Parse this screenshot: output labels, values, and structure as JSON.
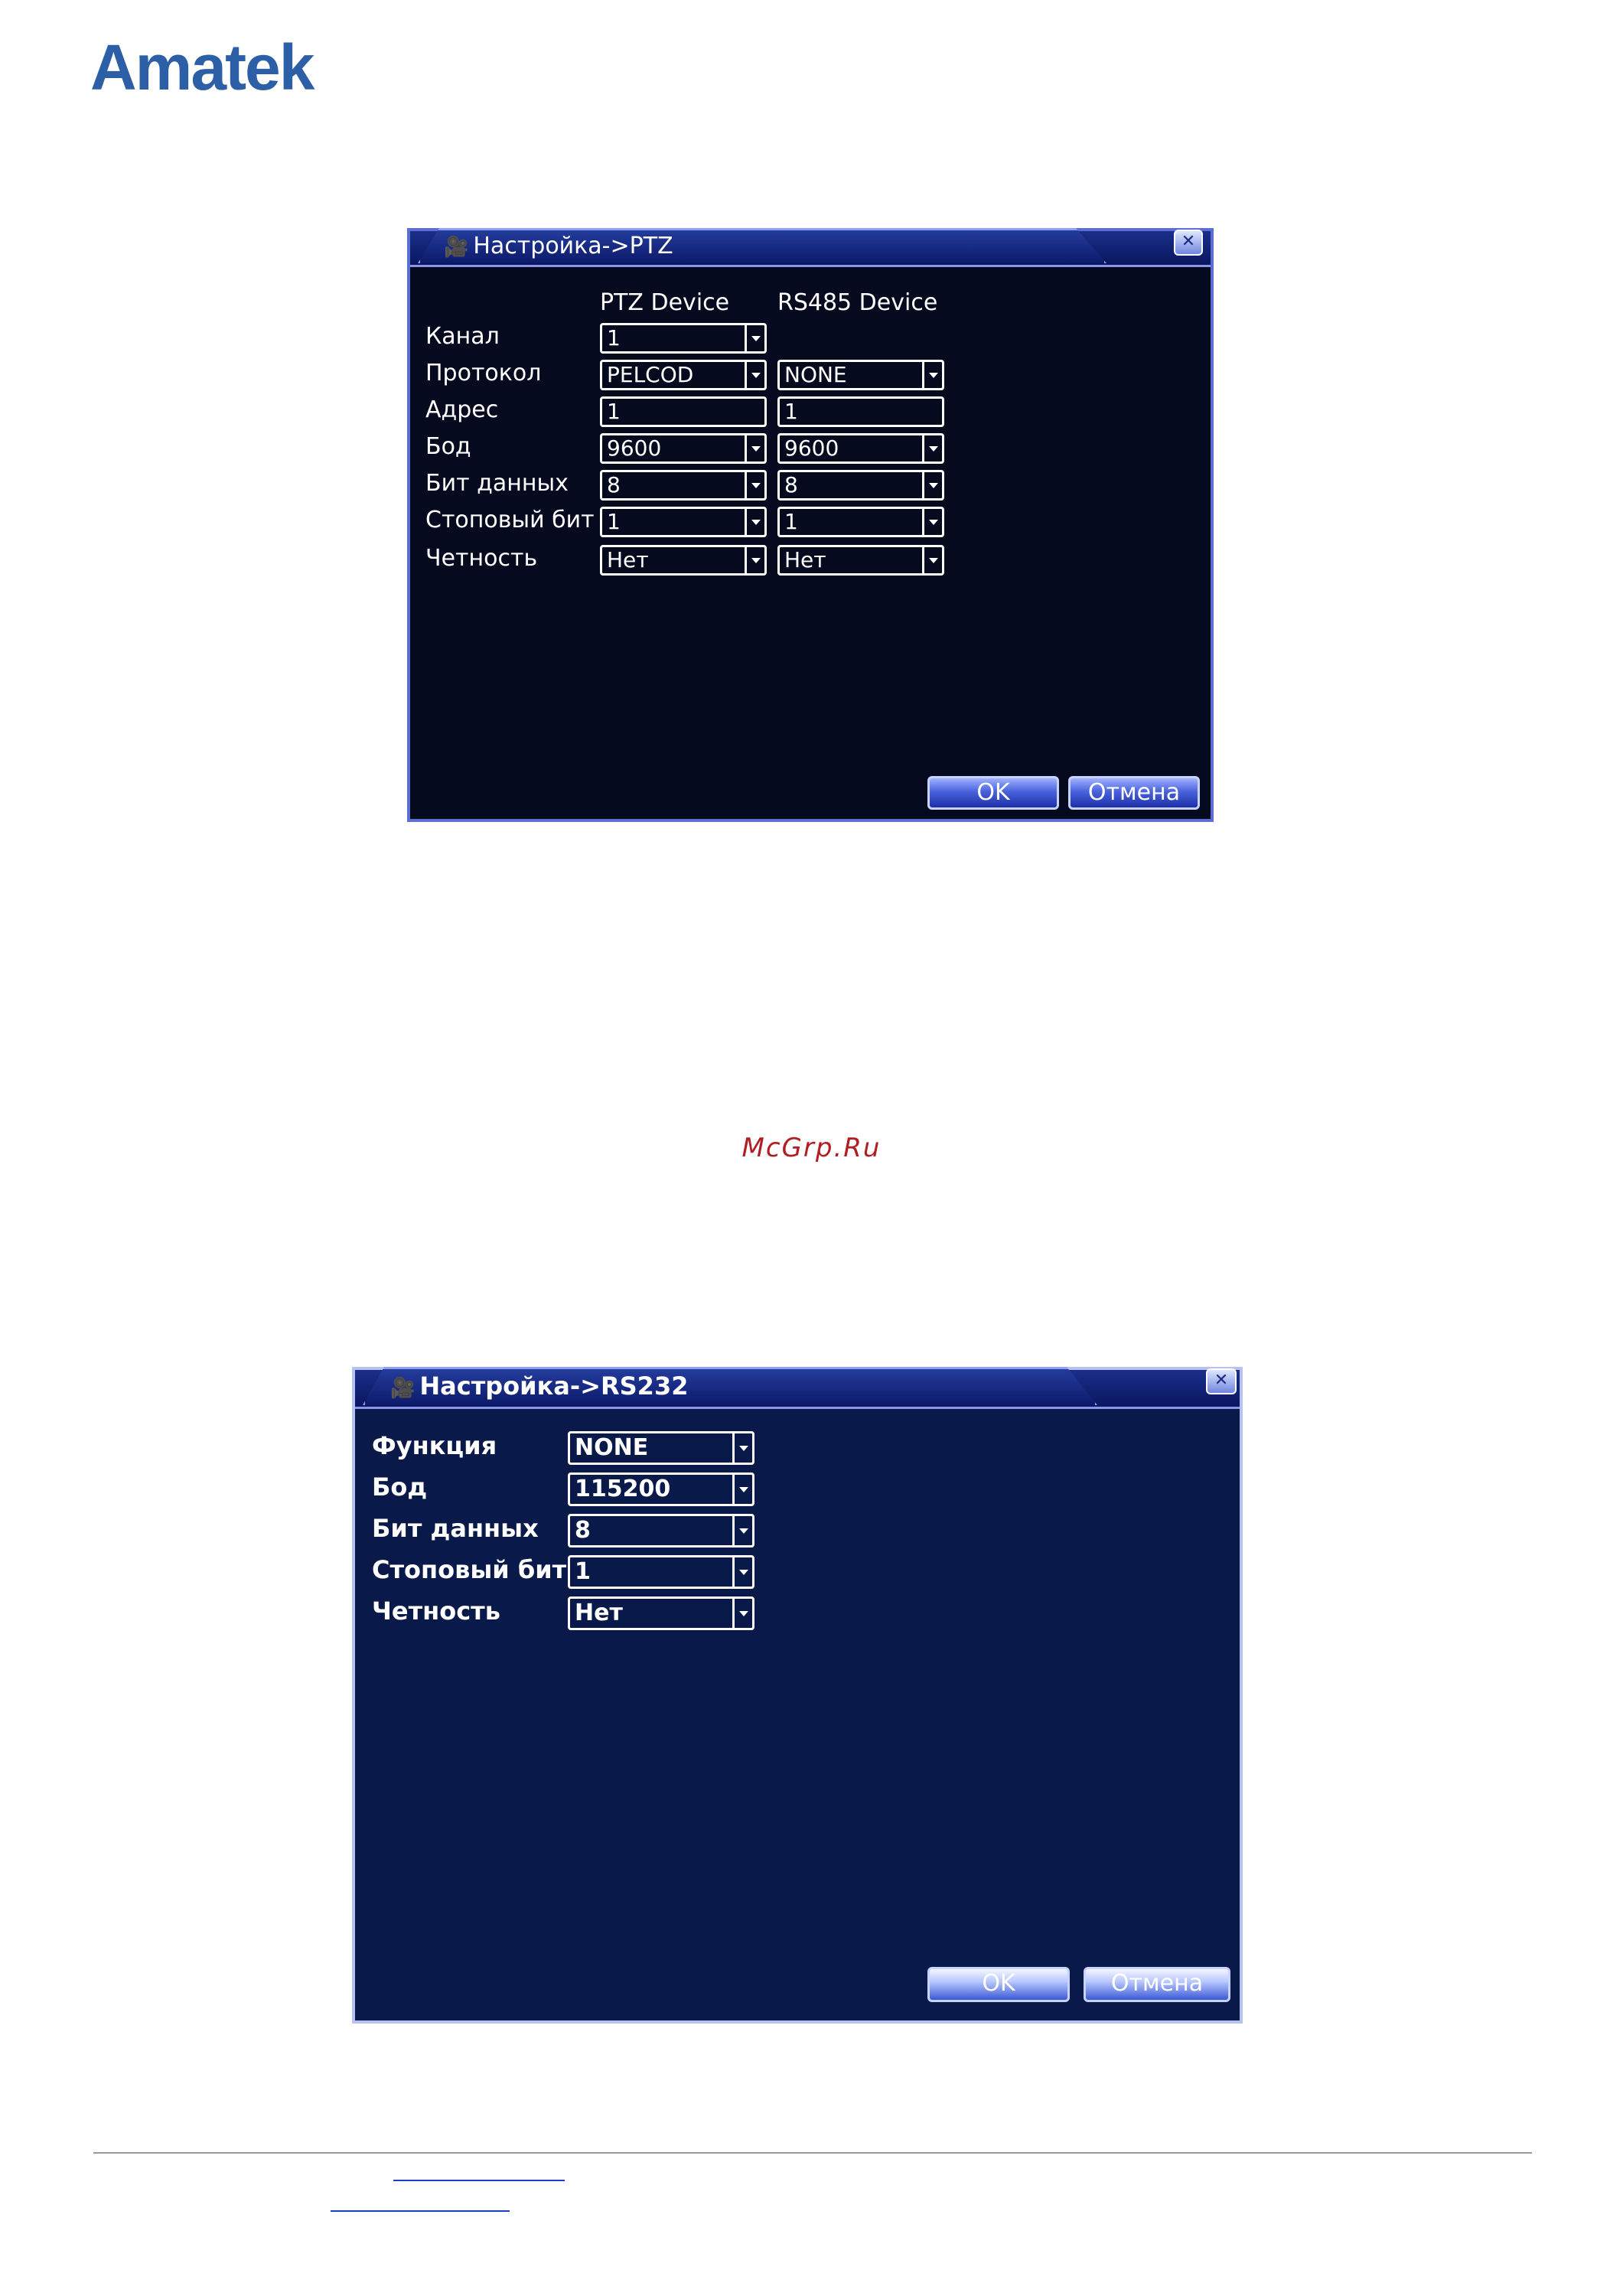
{
  "brand": {
    "logo_text": "Amatek"
  },
  "watermark": "McGrp.Ru",
  "ptz_dialog": {
    "title": "Настройка->PTZ",
    "columns": [
      "PTZ Device",
      "RS485 Device"
    ],
    "rows": [
      {
        "label": "Канал",
        "ptz": "1",
        "rs485": null,
        "ptz_dropdown": true
      },
      {
        "label": "Протокол",
        "ptz": "PELCOD",
        "rs485": "NONE",
        "ptz_dropdown": true,
        "rs485_dropdown": true
      },
      {
        "label": "Адрес",
        "ptz": "1",
        "rs485": "1",
        "ptz_dropdown": false,
        "rs485_dropdown": false
      },
      {
        "label": "Бод",
        "ptz": "9600",
        "rs485": "9600",
        "ptz_dropdown": true,
        "rs485_dropdown": true
      },
      {
        "label": "Бит данных",
        "ptz": "8",
        "rs485": "8",
        "ptz_dropdown": true,
        "rs485_dropdown": true
      },
      {
        "label": "Стоповый бит",
        "ptz": "1",
        "rs485": "1",
        "ptz_dropdown": true,
        "rs485_dropdown": true
      },
      {
        "label": "Четность",
        "ptz": "Нет",
        "rs485": "Нет",
        "ptz_dropdown": true,
        "rs485_dropdown": true
      }
    ],
    "ok_label": "OK",
    "cancel_label": "Отмена",
    "close_glyph": "✕"
  },
  "rs232_dialog": {
    "title": "Настройка->RS232",
    "rows": [
      {
        "label": "Функция",
        "value": "NONE"
      },
      {
        "label": "Бод",
        "value": "115200"
      },
      {
        "label": "Бит данных",
        "value": "8"
      },
      {
        "label": "Стоповый бит",
        "value": "1"
      },
      {
        "label": "Четность",
        "value": "Нет"
      }
    ],
    "ok_label": "OK",
    "cancel_label": "Отмена",
    "close_glyph": "✕"
  },
  "colors": {
    "logo": "#2d5fa6",
    "watermark": "#b01e23",
    "dialog_bg": "#060a1f",
    "dialog_border": "#5c6fd0",
    "button": "#4a63dc"
  }
}
